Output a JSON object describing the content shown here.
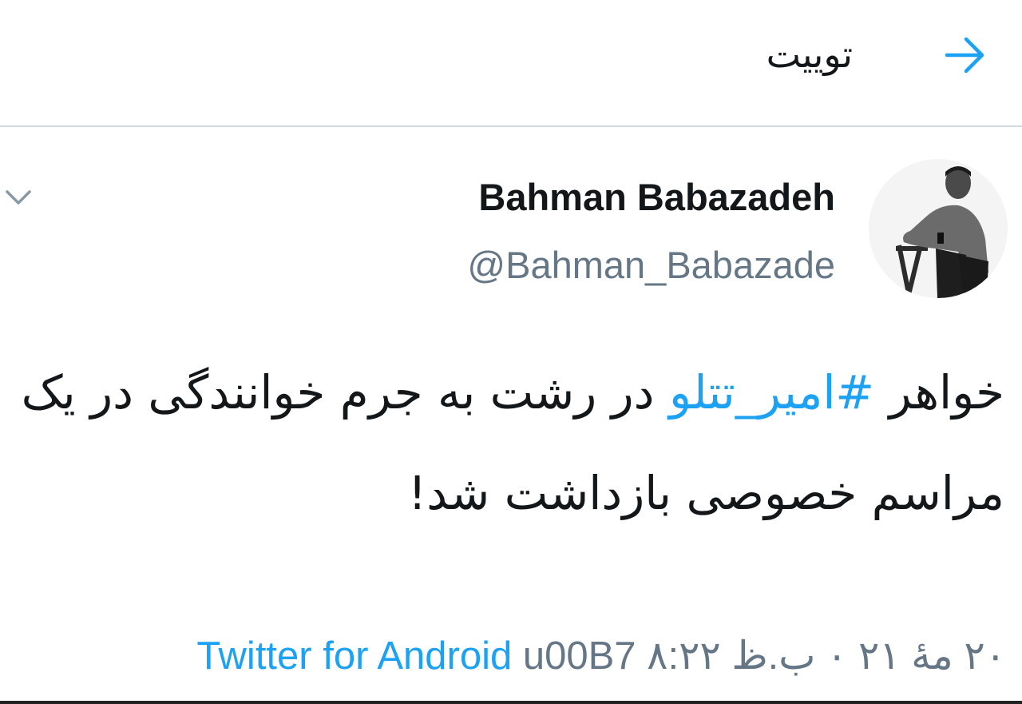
{
  "header": {
    "title": "توییت",
    "back_icon": "arrow-right-icon"
  },
  "tweet": {
    "display_name": "Bahman Babazadeh",
    "handle": "@Bahman_Babazade",
    "text_before": "خواهر ",
    "hashtag": "#امیر_تتلو",
    "text_after": " در رشت به جرم خوانندگی در یک مراسم خصوصی بازداشت شد!",
    "menu_icon": "chevron-down-icon",
    "avatar_icon": "user-photo-icon"
  },
  "meta": {
    "source": "Twitter for Android",
    "separator": " u00B7 ",
    "date": "۲۰ مهٔ ۲۱ ۰ ب.ظ ۸:۲۲"
  },
  "colors": {
    "accent": "#1da1f2",
    "secondary": "#657786",
    "text": "#14171a",
    "divider": "#d0d9df"
  }
}
